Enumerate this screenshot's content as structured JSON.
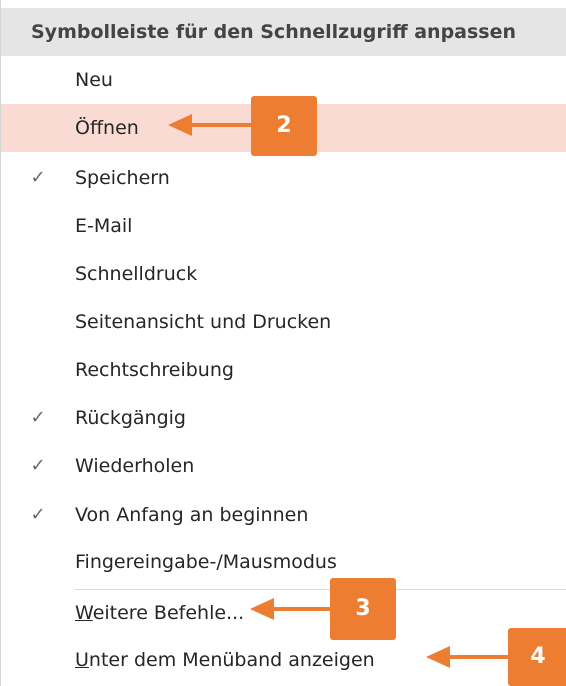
{
  "menu": {
    "title": "Symbolleiste für den Schnellzugriff anpassen",
    "items": [
      {
        "label": "Neu",
        "checked": false
      },
      {
        "label": "Öffnen",
        "checked": false,
        "highlighted": true
      },
      {
        "label": "Speichern",
        "checked": true
      },
      {
        "label": "E-Mail",
        "checked": false
      },
      {
        "label": "Schnelldruck",
        "checked": false
      },
      {
        "label": "Seitenansicht und Drucken",
        "checked": false
      },
      {
        "label": "Rechtschreibung",
        "checked": false
      },
      {
        "label": "Rückgängig",
        "checked": true
      },
      {
        "label": "Wiederholen",
        "checked": true
      },
      {
        "label": "Von Anfang an beginnen",
        "checked": true
      },
      {
        "label": "Fingereingabe-/Mausmodus",
        "checked": false
      }
    ],
    "more_commands": {
      "accel": "W",
      "rest": "eitere Befehle..."
    },
    "show_below_ribbon": {
      "accel": "U",
      "rest": "nter dem Menüband anzeigen"
    },
    "check_glyph": "✓"
  },
  "callouts": [
    {
      "label": "2"
    },
    {
      "label": "3"
    },
    {
      "label": "4"
    }
  ],
  "colors": {
    "accent": "#ed7d31",
    "highlight": "#fadbd4",
    "header_bg": "#e5e5e5"
  }
}
